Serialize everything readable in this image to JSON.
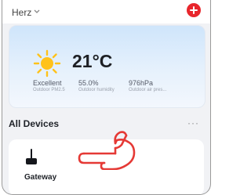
{
  "header": {
    "home_name": "Herz",
    "caret_icon": "chevron-down-icon",
    "add_icon": "add-circle-icon",
    "add_color": "#e8262c"
  },
  "weather": {
    "icon": "sun-icon",
    "temperature": "21°C",
    "stats": [
      {
        "value": "Excellent",
        "label": "Outdoor PM2.5"
      },
      {
        "value": "55.0%",
        "label": "Outdoor humidity"
      },
      {
        "value": "976hPa",
        "label": "Outdoor air pres..."
      }
    ]
  },
  "devices": {
    "title": "All Devices",
    "more_label": "···",
    "items": [
      {
        "name": "Gateway",
        "icon": "gateway-icon"
      }
    ]
  },
  "annotation": {
    "icon": "pointing-hand-icon",
    "color": "#e53935"
  }
}
